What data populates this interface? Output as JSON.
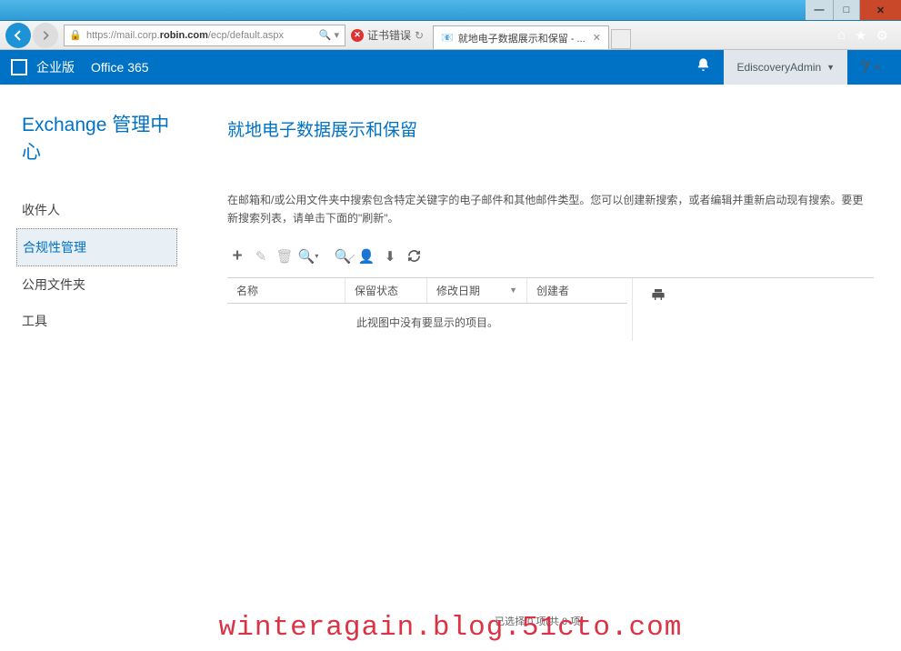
{
  "window": {
    "title": "就地电子数据展示和保留 - ..."
  },
  "browser": {
    "url_prefix": "https://mail.corp.",
    "url_bold": "robin.com",
    "url_suffix": "/ecp/default.aspx",
    "cert_error": "证书错误",
    "tab_title": "就地电子数据展示和保留 - ..."
  },
  "header": {
    "edition": "企业版",
    "product": "Office 365",
    "user": "EdiscoveryAdmin",
    "help": "?"
  },
  "sidebar": {
    "title": "Exchange 管理中心",
    "items": [
      {
        "label": "收件人",
        "active": false
      },
      {
        "label": "合规性管理",
        "active": true
      },
      {
        "label": "公用文件夹",
        "active": false
      },
      {
        "label": "工具",
        "active": false
      }
    ]
  },
  "page": {
    "heading": "就地电子数据展示和保留",
    "description": "在邮箱和/或公用文件夹中搜索包含特定关键字的电子邮件和其他邮件类型。您可以创建新搜索，或者编辑并重新启动现有搜索。要更新搜索列表，请单击下面的\"刷新\"。",
    "columns": {
      "name": "名称",
      "status": "保留状态",
      "date": "修改日期",
      "creator": "创建者"
    },
    "empty": "此视图中没有要显示的项目。",
    "status": "已选择 0 项(共 0 项)"
  },
  "watermark": "winteragain.blog.51cto.com"
}
